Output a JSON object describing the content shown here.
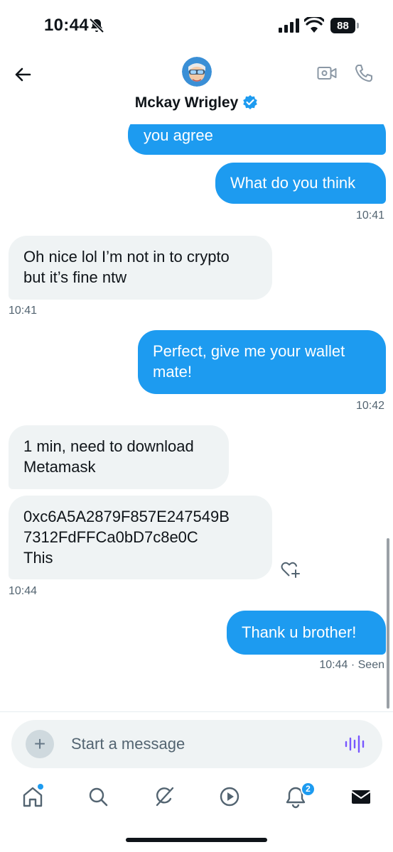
{
  "status_bar": {
    "time": "10:44",
    "battery": "88",
    "icons": [
      "bell-off-icon",
      "signal-icon",
      "wifi-icon",
      "battery-icon"
    ]
  },
  "header": {
    "contact_name": "Mckay Wrigley",
    "verified": true,
    "icons": [
      "back-arrow-icon",
      "video-call-icon",
      "phone-call-icon",
      "verified-badge-icon"
    ]
  },
  "messages": [
    {
      "direction": "out",
      "text": "you agree",
      "time": ""
    },
    {
      "direction": "out",
      "text": "What do you think",
      "time": "10:41"
    },
    {
      "direction": "in",
      "text": "Oh nice lol I’m not in to crypto\nbut it’s fine ntw",
      "time": "10:41"
    },
    {
      "direction": "out",
      "text": "Perfect, give me your wallet\nmate!",
      "time": "10:42"
    },
    {
      "direction": "in",
      "text": "1 min, need to download\nMetamask",
      "time": ""
    },
    {
      "direction": "in",
      "text": "0xc6A5A2879F857E247549B\n7312FdFFCa0bD7c8e0C\nThis",
      "time": "10:44"
    },
    {
      "direction": "out",
      "text": "Thank u brother!",
      "time": "10:44 · Seen"
    }
  ],
  "composer": {
    "add_label": "+",
    "placeholder": "Start a message"
  },
  "bottom_nav": {
    "items": [
      "home-icon",
      "search-icon",
      "grok-icon",
      "play-icon",
      "notifications-icon",
      "messages-icon"
    ],
    "notification_count": "2"
  },
  "colors": {
    "accent": "#1d9bf0",
    "incoming_bubble": "#eff3f4",
    "text": "#0f1419",
    "muted": "#536471",
    "voice": "#7856ff"
  }
}
